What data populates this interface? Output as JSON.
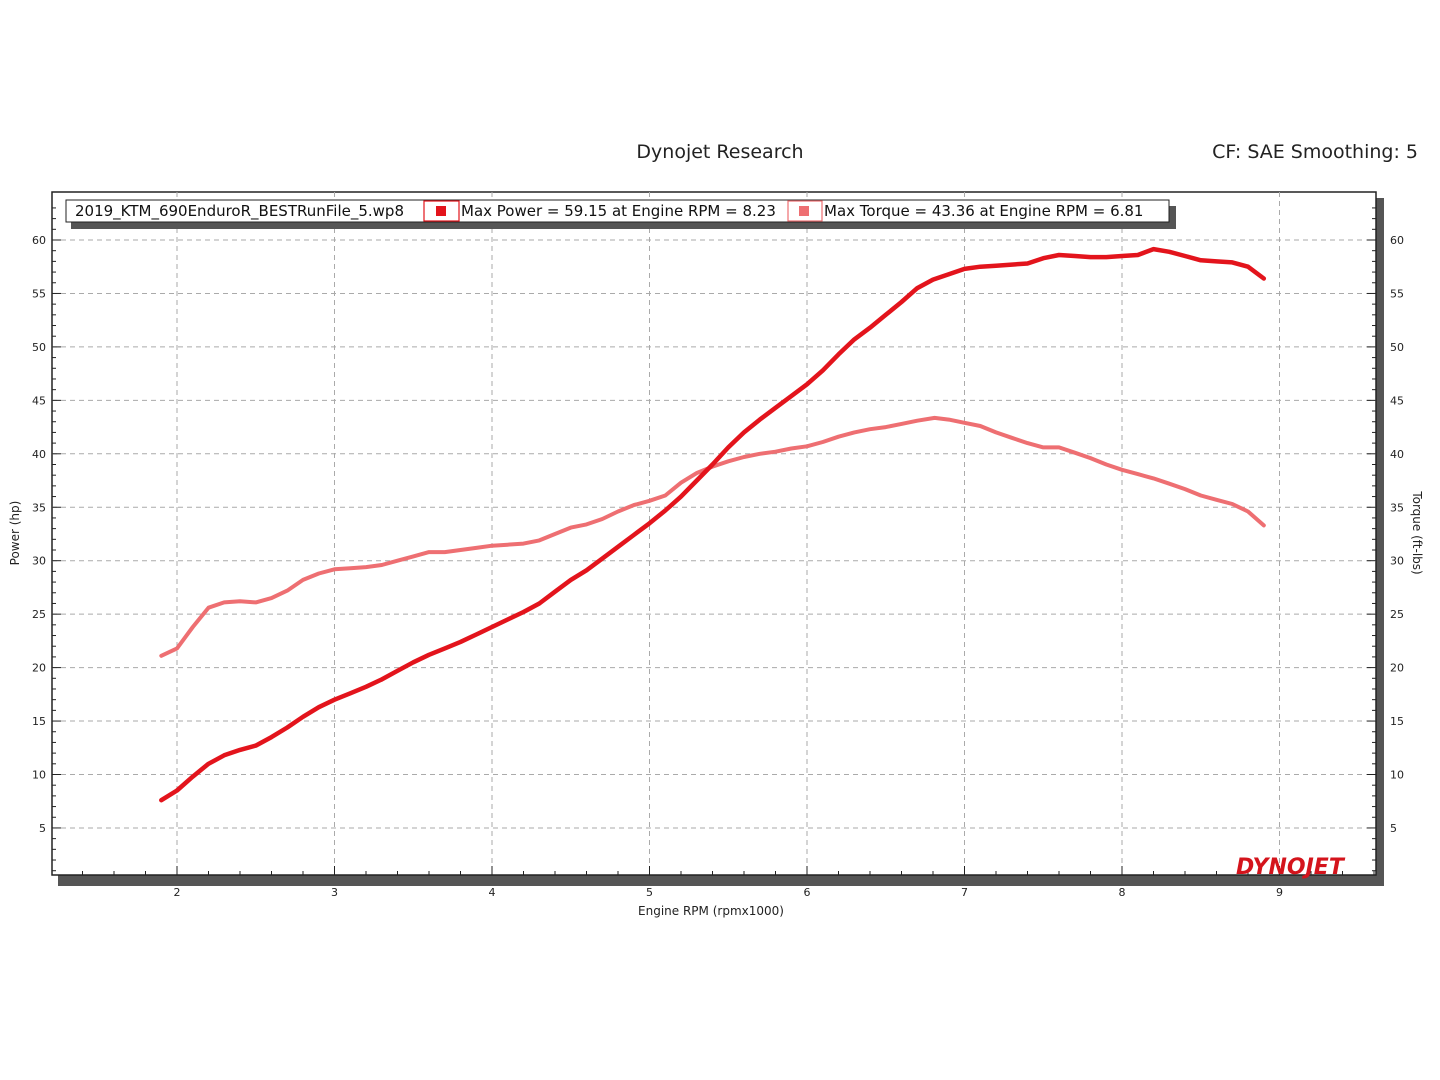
{
  "header": {
    "title": "Dynojet Research",
    "correction": "CF: SAE Smoothing: 5"
  },
  "legend": {
    "file": "2019_KTM_690EnduroR_BESTRunFile_5.wp8",
    "power": "Max Power = 59.15 at Engine RPM = 8.23",
    "torque": "Max Torque = 43.36 at Engine RPM = 6.81"
  },
  "logo": "DYNOJET",
  "colors": {
    "power": "#e3141c",
    "torque": "#ee6f72",
    "grid": "#aaaaaa",
    "logo": "#d4141c"
  },
  "chart_data": {
    "type": "line",
    "xlabel": "Engine RPM (rpmx1000)",
    "ylabel": "Power (hp)",
    "y2label": "Torque (ft-lbs)",
    "xlim": [
      1.3,
      9.8
    ],
    "ylim": [
      0,
      63
    ],
    "y2lim": [
      0,
      63
    ],
    "xticks": [
      2,
      3,
      4,
      5,
      6,
      7,
      8,
      9
    ],
    "yticks": [
      5,
      10,
      15,
      20,
      25,
      30,
      35,
      40,
      45,
      50,
      55,
      60
    ],
    "grid": true,
    "legend_position": "top-left",
    "series": [
      {
        "name": "Max Power = 59.15 at Engine RPM = 8.23",
        "axis": "left",
        "x": [
          1.9,
          2.0,
          2.1,
          2.2,
          2.3,
          2.4,
          2.5,
          2.6,
          2.7,
          2.8,
          2.9,
          3.0,
          3.1,
          3.2,
          3.3,
          3.4,
          3.5,
          3.6,
          3.7,
          3.8,
          3.9,
          4.0,
          4.1,
          4.2,
          4.3,
          4.4,
          4.5,
          4.6,
          4.7,
          4.8,
          4.9,
          5.0,
          5.1,
          5.2,
          5.3,
          5.4,
          5.5,
          5.6,
          5.7,
          5.8,
          5.9,
          6.0,
          6.1,
          6.2,
          6.3,
          6.4,
          6.5,
          6.6,
          6.7,
          6.8,
          6.9,
          7.0,
          7.1,
          7.2,
          7.3,
          7.4,
          7.5,
          7.6,
          7.7,
          7.8,
          7.9,
          8.0,
          8.1,
          8.2,
          8.3,
          8.4,
          8.5,
          8.6,
          8.7,
          8.8,
          8.9
        ],
        "values": [
          7.6,
          8.5,
          9.8,
          11.0,
          11.8,
          12.3,
          12.7,
          13.5,
          14.4,
          15.4,
          16.3,
          17.0,
          17.6,
          18.2,
          18.9,
          19.7,
          20.5,
          21.2,
          21.8,
          22.4,
          23.1,
          23.8,
          24.5,
          25.2,
          26.0,
          27.1,
          28.2,
          29.1,
          30.2,
          31.3,
          32.4,
          33.5,
          34.7,
          36.0,
          37.5,
          39.0,
          40.6,
          42.0,
          43.2,
          44.3,
          45.4,
          46.5,
          47.8,
          49.3,
          50.7,
          51.8,
          53.0,
          54.2,
          55.5,
          56.3,
          56.8,
          57.3,
          57.5,
          57.6,
          57.7,
          57.8,
          58.3,
          58.6,
          58.5,
          58.4,
          58.4,
          58.5,
          58.6,
          59.15,
          58.9,
          58.5,
          58.1,
          58.0,
          57.9,
          57.5,
          56.4
        ]
      },
      {
        "name": "Max Torque = 43.36 at Engine RPM = 6.81",
        "axis": "right",
        "x": [
          1.9,
          2.0,
          2.1,
          2.2,
          2.3,
          2.4,
          2.5,
          2.6,
          2.7,
          2.8,
          2.9,
          3.0,
          3.1,
          3.2,
          3.3,
          3.4,
          3.5,
          3.6,
          3.7,
          3.8,
          3.9,
          4.0,
          4.1,
          4.2,
          4.3,
          4.4,
          4.5,
          4.6,
          4.7,
          4.8,
          4.9,
          5.0,
          5.1,
          5.2,
          5.3,
          5.4,
          5.5,
          5.6,
          5.7,
          5.8,
          5.9,
          6.0,
          6.1,
          6.2,
          6.3,
          6.4,
          6.5,
          6.6,
          6.7,
          6.81,
          6.9,
          7.0,
          7.1,
          7.2,
          7.3,
          7.4,
          7.5,
          7.6,
          7.7,
          7.8,
          7.9,
          8.0,
          8.1,
          8.2,
          8.3,
          8.4,
          8.5,
          8.6,
          8.7,
          8.8,
          8.9
        ],
        "values": [
          21.1,
          21.8,
          23.8,
          25.6,
          26.1,
          26.2,
          26.1,
          26.5,
          27.2,
          28.2,
          28.8,
          29.2,
          29.3,
          29.4,
          29.6,
          30.0,
          30.4,
          30.8,
          30.8,
          31.0,
          31.2,
          31.4,
          31.5,
          31.6,
          31.9,
          32.5,
          33.1,
          33.4,
          33.9,
          34.6,
          35.2,
          35.6,
          36.1,
          37.3,
          38.2,
          38.8,
          39.3,
          39.7,
          40.0,
          40.2,
          40.5,
          40.7,
          41.1,
          41.6,
          42.0,
          42.3,
          42.5,
          42.8,
          43.1,
          43.36,
          43.2,
          42.9,
          42.6,
          42.0,
          41.5,
          41.0,
          40.6,
          40.6,
          40.1,
          39.6,
          39.0,
          38.5,
          38.1,
          37.7,
          37.2,
          36.7,
          36.1,
          35.7,
          35.3,
          34.6,
          33.3
        ]
      }
    ]
  }
}
